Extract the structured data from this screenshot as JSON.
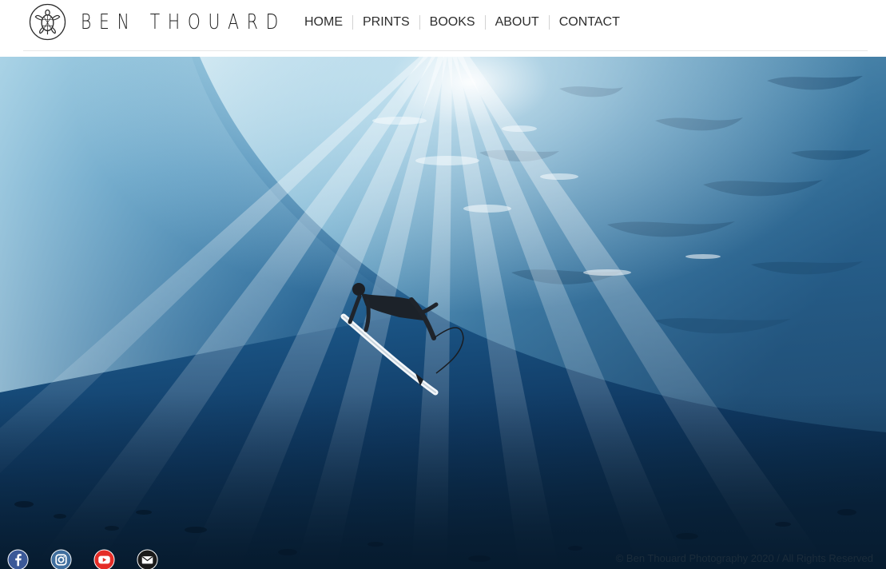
{
  "site": {
    "logo_text": "BEN THOUARD",
    "logo_icon": "turtle-icon"
  },
  "nav": {
    "items": [
      {
        "label": "HOME"
      },
      {
        "label": "PRINTS"
      },
      {
        "label": "BOOKS"
      },
      {
        "label": "ABOUT"
      },
      {
        "label": "CONTACT"
      }
    ]
  },
  "hero": {
    "subject": "surfer duck-diving under a wave with sun rays in blue ocean water"
  },
  "social": {
    "icons": [
      "facebook-icon",
      "instagram-icon",
      "youtube-icon",
      "email-icon"
    ]
  },
  "footer": {
    "copyright": "© Ben Thouard Photography 2020 / All Rights Reserved"
  },
  "colors": {
    "nav_text": "#2d2d2d",
    "water_deep": "#0c2a48",
    "water_mid": "#1c5f8c",
    "water_light": "#9fd0e6",
    "facebook": "#3b5998",
    "youtube": "#e52d27"
  }
}
